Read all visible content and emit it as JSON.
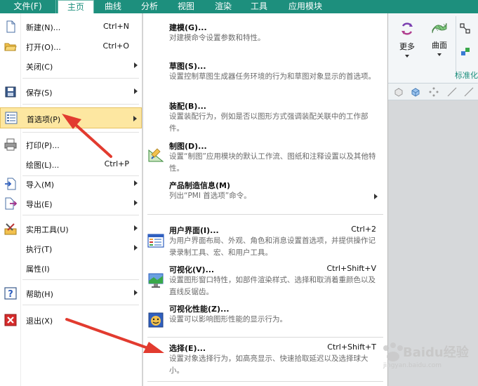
{
  "menubar": {
    "tabs": [
      {
        "label": "文件(F)"
      },
      {
        "label": "主页"
      },
      {
        "label": "曲线"
      },
      {
        "label": "分析"
      },
      {
        "label": "视图"
      },
      {
        "label": "渲染"
      },
      {
        "label": "工具"
      },
      {
        "label": "应用模块"
      }
    ],
    "active_tab": "主页"
  },
  "ribbon": {
    "more_label": "更多",
    "surface_label": "曲面",
    "group_label": "标准化"
  },
  "file_menu": {
    "items": [
      {
        "label": "新建(N)...",
        "shortcut": "Ctrl+N",
        "icon": "new-file-icon"
      },
      {
        "label": "打开(O)...",
        "shortcut": "Ctrl+O",
        "icon": "open-folder-icon"
      },
      {
        "label": "关闭(C)",
        "icon": ""
      },
      {
        "label": "保存(S)",
        "icon": "save-icon"
      },
      {
        "label": "首选项(P)",
        "icon": "preferences-icon"
      },
      {
        "label": "打印(P)...",
        "icon": "printer-icon"
      },
      {
        "label": "绘图(L)...",
        "shortcut": "Ctrl+P",
        "icon": ""
      },
      {
        "label": "导入(M)",
        "icon": "import-icon"
      },
      {
        "label": "导出(E)",
        "icon": "export-icon"
      },
      {
        "label": "实用工具(U)",
        "icon": "utilities-icon"
      },
      {
        "label": "执行(T)",
        "icon": ""
      },
      {
        "label": "属性(I)",
        "icon": ""
      },
      {
        "label": "帮助(H)",
        "icon": "help-icon"
      },
      {
        "label": "退出(X)",
        "icon": "exit-icon"
      }
    ]
  },
  "preferences_submenu": {
    "items": [
      {
        "title": "建模(G)...",
        "desc": "对建模命令设置参数和特性。"
      },
      {
        "title": "草图(S)...",
        "desc": "设置控制草图生成器任务环境的行为和草图对象显示的首选项。"
      },
      {
        "title": "装配(B)...",
        "desc": "设置装配行为，例如是否以图形方式强调装配关联中的工作部件。"
      },
      {
        "title": "制图(D)...",
        "desc": "设置“制图”应用模块的默认工作流、图纸和注释设置以及其他特性。"
      },
      {
        "title": "产品制造信息(M)",
        "desc": "列出“PMI 首选项”命令。"
      },
      {
        "title": "用户界面(I)...",
        "shortcut": "Ctrl+2",
        "desc": "为用户界面布局、外观、角色和消息设置首选项，并提供操作记录录制工具、宏、和用户工具。"
      },
      {
        "title": "可视化(V)...",
        "shortcut": "Ctrl+Shift+V",
        "desc": "设置图形窗口特性，如部件渲染样式、选择和取消着重颜色以及直线反锯齿。"
      },
      {
        "title": "可视化性能(Z)...",
        "desc": "设置可以影响图形性能的显示行为。"
      },
      {
        "title": "选择(E)...",
        "shortcut": "Ctrl+Shift+T",
        "desc": "设置对象选择行为，如高亮显示、快速拾取延迟以及选择球大小。"
      }
    ]
  },
  "watermark": {
    "text": "Baidu经验",
    "sub": "jingyan.baidu.com"
  },
  "colors": {
    "ribbon_accent": "#1d8f7d",
    "selected_bg": "#fde7a1",
    "annotation": "#e23b2f"
  }
}
